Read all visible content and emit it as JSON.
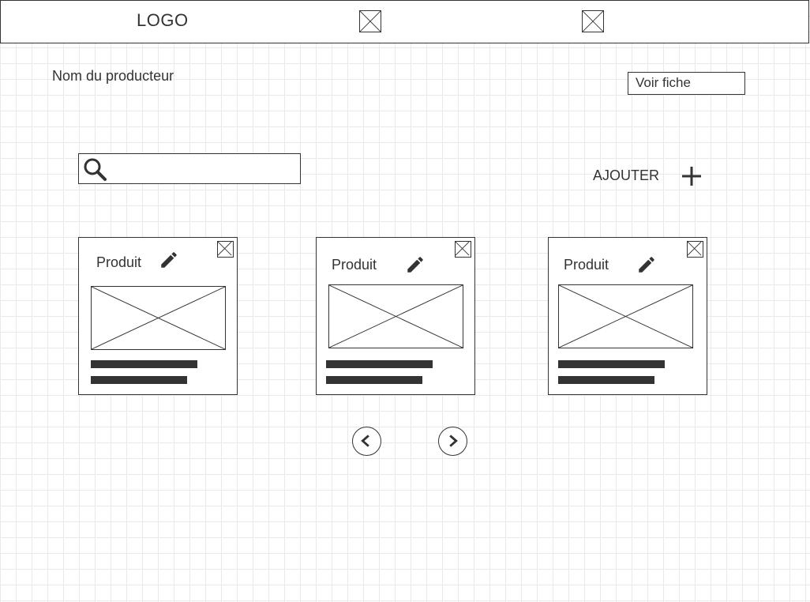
{
  "header": {
    "logo": "LOGO"
  },
  "producer": {
    "name": "Nom du producteur",
    "view_button": "Voir fiche"
  },
  "search": {
    "value": "",
    "icon": "search-icon"
  },
  "add": {
    "label": "AJOUTER",
    "icon": "plus-icon"
  },
  "products": [
    {
      "title": "Produit"
    },
    {
      "title": "Produit"
    },
    {
      "title": "Produit"
    }
  ],
  "pagination": {
    "prev_icon": "chevron-left-icon",
    "next_icon": "chevron-right-icon"
  },
  "colors": {
    "stroke": "#333333",
    "grid": "#e9e9e9"
  }
}
